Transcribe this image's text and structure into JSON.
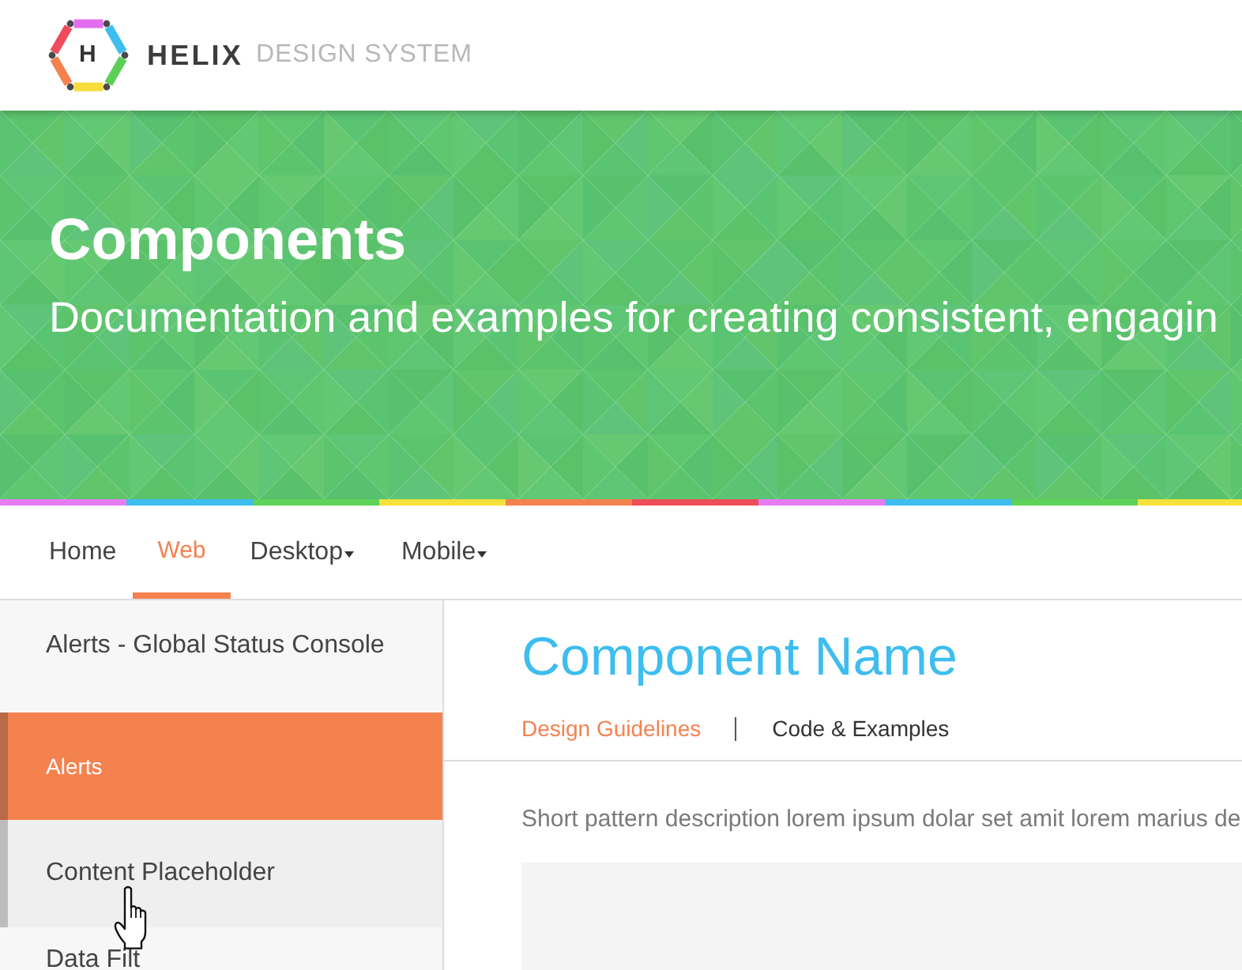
{
  "header": {
    "logo": {
      "letter": "H"
    },
    "brand": "HELIX",
    "tagline": "DESIGN SYSTEM"
  },
  "hero": {
    "title": "Components",
    "subtitle": "Documentation and examples for creating consistent, engagin"
  },
  "nav": {
    "items": [
      {
        "label": "Home",
        "selected": false,
        "has_menu": false
      },
      {
        "label": "Web",
        "selected": true,
        "has_menu": false
      },
      {
        "label": "Desktop",
        "selected": false,
        "has_menu": true
      },
      {
        "label": "Mobile",
        "selected": false,
        "has_menu": true
      }
    ]
  },
  "sidebar": {
    "items": [
      {
        "label": "Alerts - Global Status Console",
        "selected": false,
        "hovered": false
      },
      {
        "label": "Alerts",
        "selected": true,
        "hovered": false
      },
      {
        "label": "Content Placeholder",
        "selected": false,
        "hovered": true
      },
      {
        "label": "Data Filt",
        "selected": false,
        "hovered": false
      }
    ]
  },
  "content": {
    "title": "Component Name",
    "tabs": [
      {
        "label": "Design Guidelines",
        "selected": true
      },
      {
        "label": "Code & Examples",
        "selected": false
      }
    ],
    "description": "Short pattern description lorem ipsum dolar set amit lorem marius de"
  }
}
